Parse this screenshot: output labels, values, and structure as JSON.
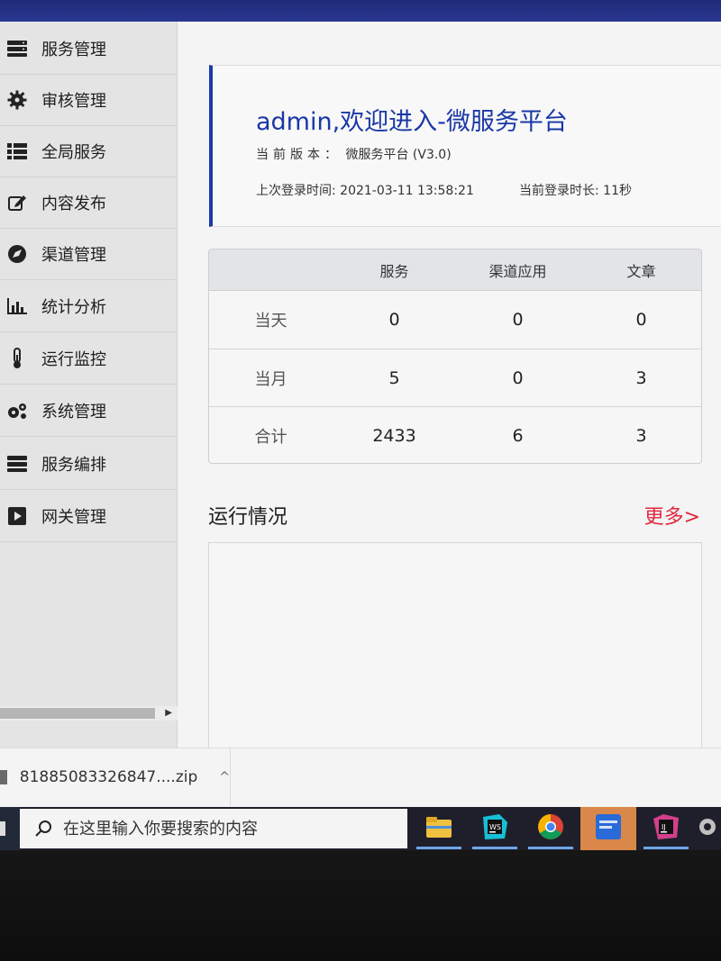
{
  "sidebar": {
    "items": [
      {
        "label": "服务管理",
        "icon": "server-icon"
      },
      {
        "label": "审核管理",
        "icon": "gear-icon"
      },
      {
        "label": "全局服务",
        "icon": "list-icon"
      },
      {
        "label": "内容发布",
        "icon": "edit-icon"
      },
      {
        "label": "渠道管理",
        "icon": "compass-icon"
      },
      {
        "label": "统计分析",
        "icon": "bar-chart-icon"
      },
      {
        "label": "运行监控",
        "icon": "thermometer-icon"
      },
      {
        "label": "系统管理",
        "icon": "cogs-icon"
      },
      {
        "label": "服务编排",
        "icon": "server-icon"
      },
      {
        "label": "网关管理",
        "icon": "play-square-icon"
      }
    ]
  },
  "welcome": {
    "title": "admin,欢迎进入-微服务平台",
    "version_key": "当前版本：",
    "version_value": "微服务平台 (V3.0)",
    "last_login": "上次登录时间: 2021-03-11 13:58:21",
    "login_duration": "当前登录时长: 11秒"
  },
  "stats": {
    "columns": [
      "服务",
      "渠道应用",
      "文章"
    ],
    "rows": [
      {
        "label": "当天",
        "values": [
          "0",
          "0",
          "0"
        ]
      },
      {
        "label": "当月",
        "values": [
          "5",
          "0",
          "3"
        ]
      },
      {
        "label": "合计",
        "values": [
          "2433",
          "6",
          "3"
        ]
      }
    ]
  },
  "running": {
    "title": "运行情况",
    "more": "更多>"
  },
  "downloads": {
    "file_name": "81885083326847....zip",
    "chevron": "^"
  },
  "taskbar": {
    "search_placeholder": "在这里输入你要搜索的内容",
    "apps": [
      {
        "icon": "file-explorer-icon",
        "color": "#f0c040"
      },
      {
        "icon": "webstorm-icon",
        "color": "#1c1c1c"
      },
      {
        "icon": "chrome-icon",
        "color": "#db4437"
      },
      {
        "icon": "app-icon",
        "color": "#2a6ad8"
      },
      {
        "icon": "intellij-icon",
        "color": "#1c1c1c"
      },
      {
        "icon": "settings-icon",
        "color": "#c0c0c0"
      }
    ]
  },
  "colors": {
    "accent": "#1a37a6",
    "more_link": "#e0283c",
    "sidebar_bg": "#e4e4e4"
  }
}
